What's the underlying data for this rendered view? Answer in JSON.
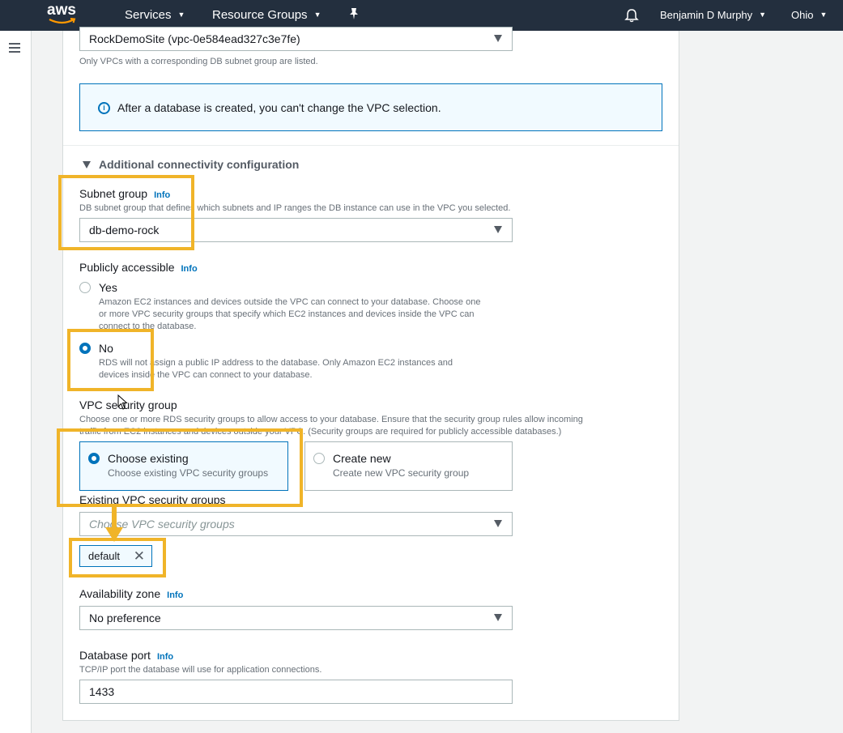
{
  "nav": {
    "logo": "aws",
    "services": "Services",
    "resource_groups": "Resource Groups",
    "user": "Benjamin D Murphy",
    "region": "Ohio"
  },
  "vpc": {
    "value": "RockDemoSite (vpc-0e584ead327c3e7fe)",
    "help": "Only VPCs with a corresponding DB subnet group are listed.",
    "info_notice": "After a database is created, you can't change the VPC selection."
  },
  "additional": {
    "heading": "Additional connectivity configuration"
  },
  "subnet": {
    "label": "Subnet group",
    "info": "Info",
    "help": "DB subnet group that defines which subnets and IP ranges the DB instance can use in the VPC you selected.",
    "value": "db-demo-rock"
  },
  "public": {
    "label": "Publicly accessible",
    "info": "Info",
    "yes_label": "Yes",
    "yes_desc_1": "Amazon EC2 instances and devices outside the VPC can connect to your database. Choose one",
    "yes_desc_2": "or more VPC security groups that specify which EC2 instances and devices inside the VPC can",
    "yes_desc_3": "connect to the database.",
    "no_label": "No",
    "no_desc_1": "RDS will not assign a public IP address to the database. Only Amazon EC2 instances and",
    "no_desc_2": "devices inside the VPC can connect to your database.",
    "selected": "No"
  },
  "sg": {
    "label": "VPC security group",
    "help_1": "Choose one or more RDS security groups to allow access to your database. Ensure that the security group rules allow incoming",
    "help_2": "traffic from EC2 instances and devices outside your VPC. (Security groups are required for publicly accessible databases.)",
    "existing_title": "Choose existing",
    "existing_desc": "Choose existing VPC security groups",
    "new_title": "Create new",
    "new_desc": "Create new VPC security group",
    "existing_label": "Existing VPC security groups",
    "placeholder": "Choose VPC security groups",
    "token": "default"
  },
  "az": {
    "label": "Availability zone",
    "info": "Info",
    "value": "No preference"
  },
  "port": {
    "label": "Database port",
    "info": "Info",
    "help": "TCP/IP port the database will use for application connections.",
    "value": "1433"
  },
  "colors": {
    "nav_bg": "#232f3e",
    "accent": "#0073bb",
    "highlight": "#f0b429"
  }
}
